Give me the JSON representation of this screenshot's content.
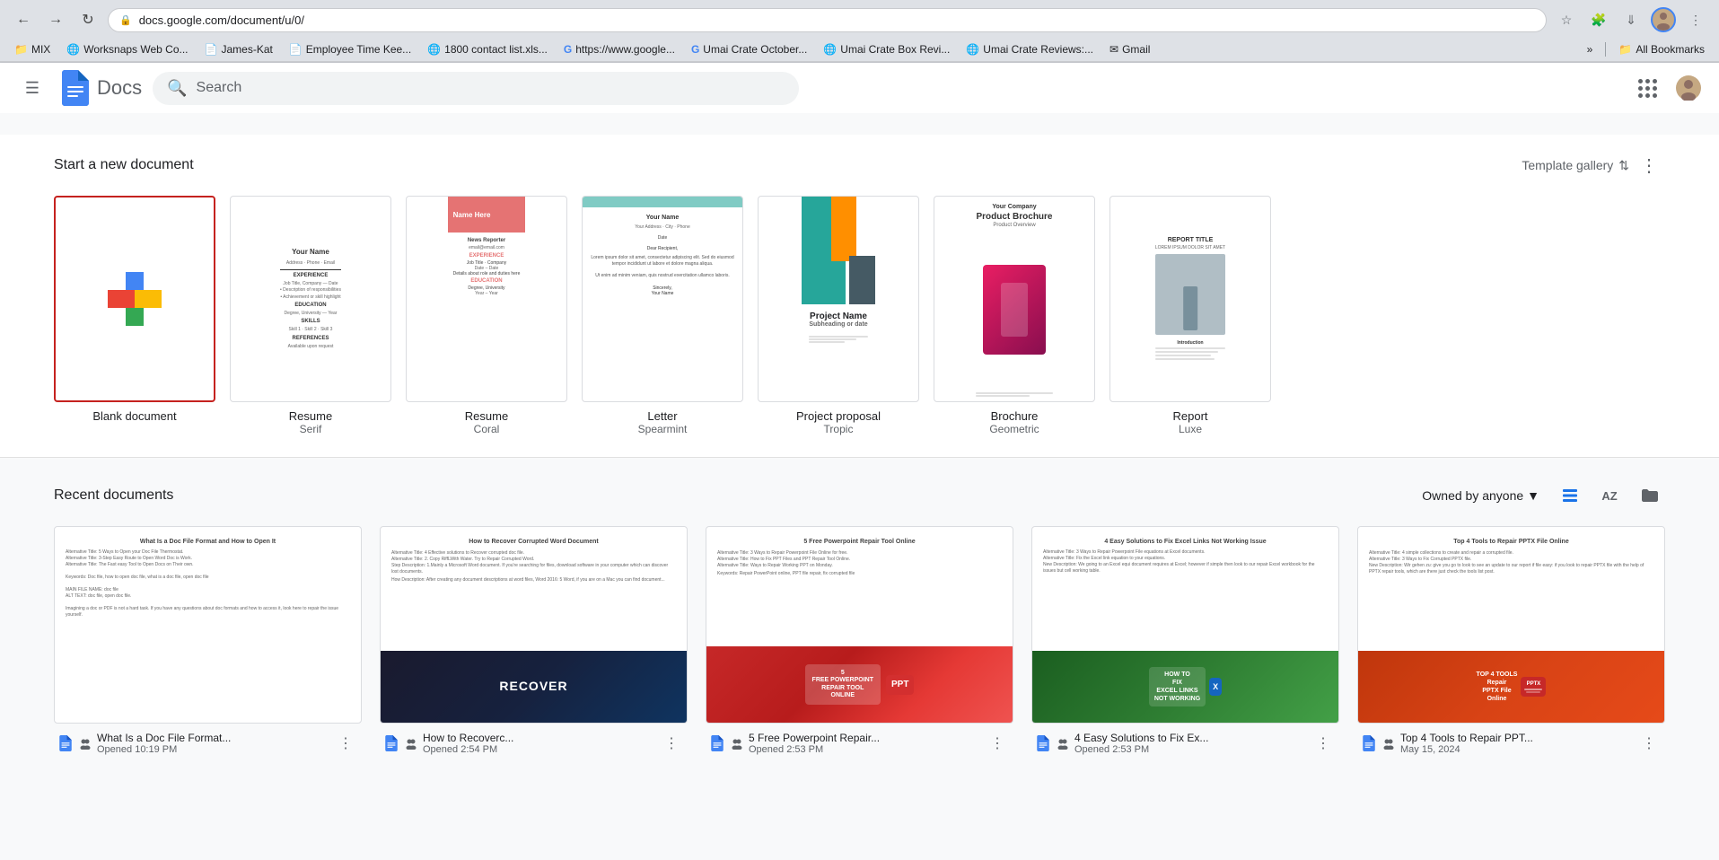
{
  "browser": {
    "url": "docs.google.com/document/u/0/",
    "back_btn": "←",
    "forward_btn": "→",
    "refresh_btn": "↻",
    "bookmarks": [
      {
        "icon": "📁",
        "label": "MIX"
      },
      {
        "icon": "🌐",
        "label": "Worksnaps Web Co..."
      },
      {
        "icon": "📄",
        "label": "James-Kat"
      },
      {
        "icon": "📄",
        "label": "Employee Time Kee..."
      },
      {
        "icon": "🌐",
        "label": "1800 contact list.xls..."
      },
      {
        "icon": "G",
        "label": "https://www.google..."
      },
      {
        "icon": "G",
        "label": "Umai Crate October..."
      },
      {
        "icon": "🌐",
        "label": "Umai Crate Box Revi..."
      },
      {
        "icon": "🌐",
        "label": "Umai Crate Reviews:..."
      },
      {
        "icon": "✉",
        "label": "Gmail"
      }
    ],
    "all_bookmarks": "All Bookmarks"
  },
  "app": {
    "menu_icon": "☰",
    "logo_text": "Docs",
    "search_placeholder": "Search",
    "apps_icon": "⋮⋮⋮",
    "account_avatar": "👤"
  },
  "templates": {
    "section_title": "Start a new document",
    "gallery_label": "Template gallery",
    "more_options": "⋮",
    "cards": [
      {
        "id": "blank",
        "label": "Blank document",
        "sublabel": ""
      },
      {
        "id": "resume-serif",
        "label": "Resume",
        "sublabel": "Serif"
      },
      {
        "id": "resume-coral",
        "label": "Resume",
        "sublabel": "Coral"
      },
      {
        "id": "letter-spearmint",
        "label": "Letter",
        "sublabel": "Spearmint"
      },
      {
        "id": "project-tropic",
        "label": "Project proposal",
        "sublabel": "Tropic"
      },
      {
        "id": "brochure-geometric",
        "label": "Brochure",
        "sublabel": "Geometric"
      },
      {
        "id": "report-luxe",
        "label": "Report",
        "sublabel": "Luxe"
      }
    ]
  },
  "recent": {
    "section_title": "Recent documents",
    "owned_by_label": "Owned by anyone",
    "owned_by_arrow": "▾",
    "list_view_icon": "☰",
    "sort_icon": "AZ",
    "folder_icon": "📁",
    "docs": [
      {
        "id": "doc1",
        "name": "What Is a Doc File Format...",
        "time": "Opened 10:19 PM",
        "thumb_title": "What Is a Doc File Format and How to Open It",
        "has_image": false
      },
      {
        "id": "doc2",
        "name": "How to Recoverc...",
        "time": "Opened 2:54 PM",
        "thumb_title": "How to Recover Corrupted Word Document",
        "has_image": true,
        "image_type": "recover"
      },
      {
        "id": "doc3",
        "name": "5 Free Powerpoint Repair...",
        "time": "Opened 2:53 PM",
        "thumb_title": "5 Free Powerpoint Repair Tool Online",
        "has_image": true,
        "image_type": "ppt"
      },
      {
        "id": "doc4",
        "name": "4 Easy Solutions to Fix Ex...",
        "time": "Opened 2:53 PM",
        "thumb_title": "4 Easy Solutions to Fix Excel Links Not Working Issue",
        "has_image": true,
        "image_type": "excel"
      },
      {
        "id": "doc5",
        "name": "Top 4 Tools to Repair PPT...",
        "time": "May 15, 2024",
        "thumb_title": "Top 4 Tools to Repair PPTX File Online",
        "has_image": true,
        "image_type": "pptx-tools"
      }
    ]
  }
}
